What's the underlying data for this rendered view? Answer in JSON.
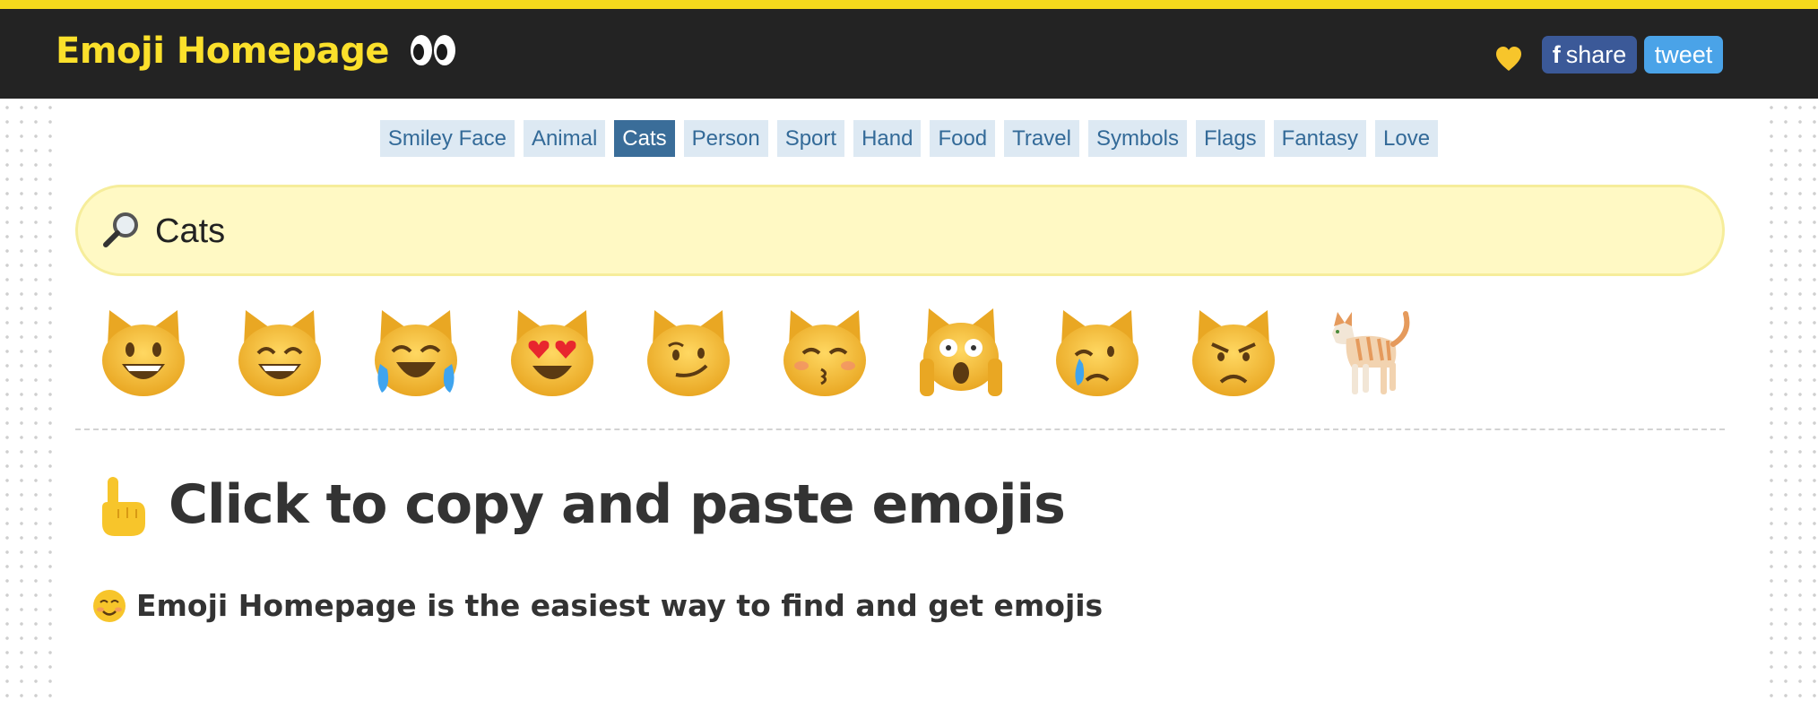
{
  "header": {
    "brand": "Emoji Homepage",
    "brand_icon": "eyes-icon",
    "favorite_icon": "yellow-heart-icon",
    "share": {
      "f": "f",
      "label": "share"
    },
    "tweet": "tweet"
  },
  "categories": [
    {
      "label": "Smiley Face",
      "active": false
    },
    {
      "label": "Animal",
      "active": false
    },
    {
      "label": "Cats",
      "active": true
    },
    {
      "label": "Person",
      "active": false
    },
    {
      "label": "Sport",
      "active": false
    },
    {
      "label": "Hand",
      "active": false
    },
    {
      "label": "Food",
      "active": false
    },
    {
      "label": "Travel",
      "active": false
    },
    {
      "label": "Symbols",
      "active": false
    },
    {
      "label": "Flags",
      "active": false
    },
    {
      "label": "Fantasy",
      "active": false
    },
    {
      "label": "Love",
      "active": false
    }
  ],
  "search": {
    "value": "Cats",
    "icon": "magnifying-glass-icon"
  },
  "emojis": [
    "grinning-cat",
    "grinning-cat-smiling-eyes",
    "cat-tears-of-joy",
    "heart-eyes-cat",
    "wry-smile-cat",
    "kissing-cat",
    "weary-cat",
    "crying-cat",
    "pouting-cat",
    "cat"
  ],
  "content": {
    "heading": "Click to copy and paste emojis",
    "heading_icon": "pointing-up-hand-icon",
    "subheading": "Emoji Homepage is the easiest way to find and get emojis",
    "subheading_icon": "smiling-face-icon"
  },
  "colors": {
    "topbar_bg": "#232323",
    "brand_yellow": "#fbe02b",
    "facebook": "#3b5998",
    "twitter": "#4aa3e8",
    "tab_bg": "#dde9f3",
    "tab_active_bg": "#3a6d99",
    "search_bg": "#fff9c4"
  }
}
